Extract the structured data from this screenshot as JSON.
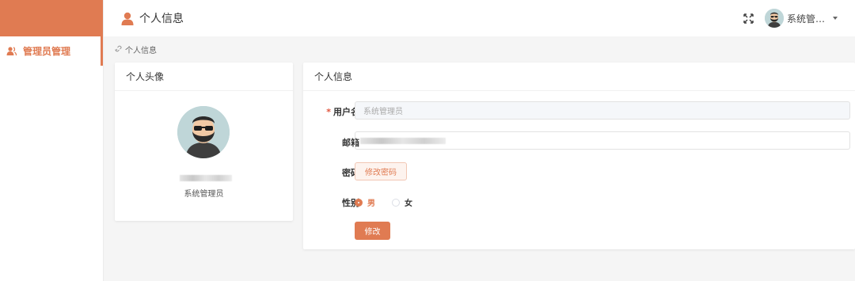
{
  "sidebar": {
    "items": [
      {
        "label": "管理员管理",
        "icon": "user-icon"
      }
    ]
  },
  "header": {
    "title": "个人信息",
    "title_icon": "person-icon",
    "user_name": "系统管…",
    "fullscreen_icon": "fullscreen-icon"
  },
  "breadcrumb": {
    "items": [
      "个人信息"
    ]
  },
  "avatar_card": {
    "title": "个人头像",
    "display_name": "系统管理员"
  },
  "info_card": {
    "title": "个人信息",
    "username_label": "用户名",
    "username_placeholder": "系统管理员",
    "email_label": "邮箱",
    "password_label": "密码",
    "change_password_button": "修改密码",
    "gender_label": "性别",
    "gender_options": [
      "男",
      "女"
    ],
    "gender_selected": "男",
    "submit_button": "修改"
  },
  "colors": {
    "accent": "#e07b52",
    "background": "#f5f5f5"
  }
}
